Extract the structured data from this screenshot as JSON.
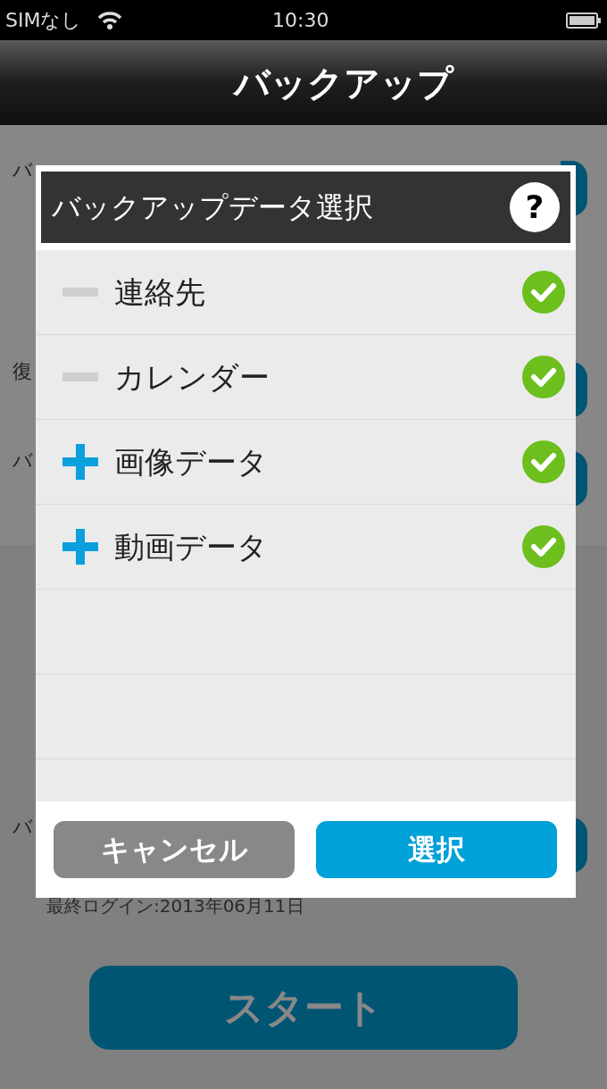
{
  "status_bar": {
    "carrier": "SIMなし",
    "time": "10:30"
  },
  "nav_bar": {
    "title": "バックアップ"
  },
  "background": {
    "labels": [
      "バ",
      "復",
      "バ",
      "バ"
    ],
    "last_login": "最終ログイン:2013年06月11日",
    "start_button": "スタート"
  },
  "dialog": {
    "title": "バックアップデータ選択",
    "help": "?",
    "items": [
      {
        "label": "連絡先",
        "kind": "minus",
        "checked": true
      },
      {
        "label": "カレンダー",
        "kind": "minus",
        "checked": true
      },
      {
        "label": "画像データ",
        "kind": "plus",
        "checked": true
      },
      {
        "label": "動画データ",
        "kind": "plus",
        "checked": true
      }
    ],
    "cancel_button": "キャンセル",
    "select_button": "選択"
  }
}
